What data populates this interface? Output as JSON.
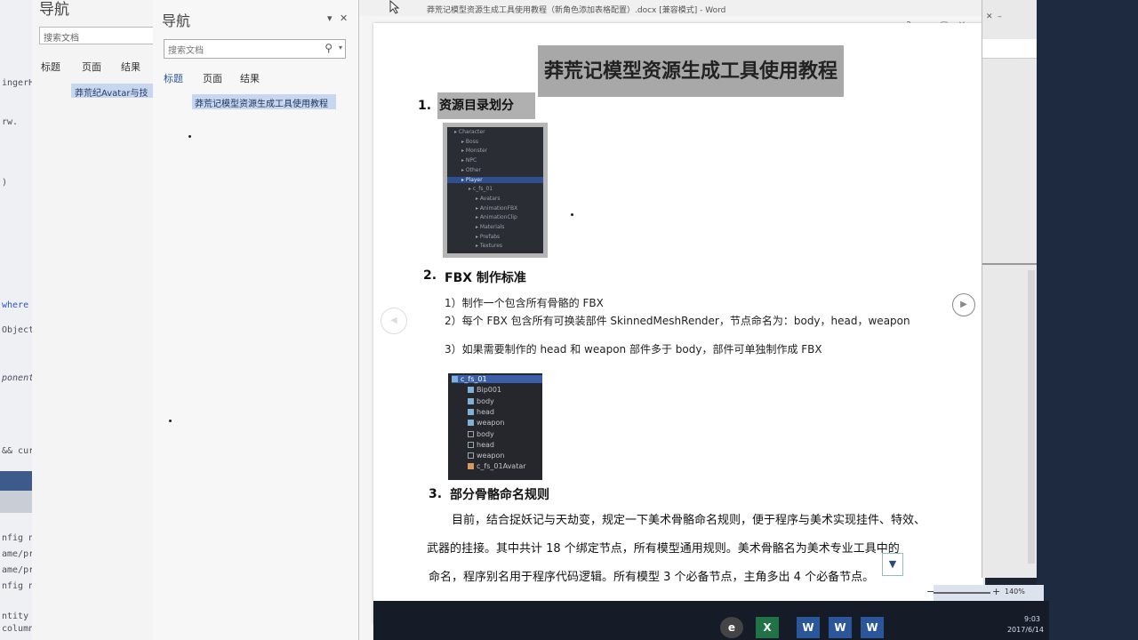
{
  "code_editor": {
    "lines": [
      "ingerHe",
      "rw.",
      ")",
      "where",
      "Object",
      "ponent<",
      "&& curIn",
      "nfig not fo",
      "ame/prefa",
      "ame/prefa",
      "nfig not fo",
      "ntity is not",
      "column <fil"
    ]
  },
  "back_nav": {
    "title": "导航",
    "search_placeholder": "搜索文档",
    "tabs": [
      "标题",
      "页面",
      "结果"
    ],
    "heading_item": "莽荒纪Avatar与技"
  },
  "nav_pane": {
    "title": "导航",
    "menu_icon": "▾",
    "close_icon": "✕",
    "search_placeholder": "搜索文档",
    "tabs": [
      "标题",
      "页面",
      "结果"
    ],
    "heading_item": "莽荒记模型资源生成工具使用教程"
  },
  "window": {
    "title": "莽荒记模型资源生成工具使用教程（新角色添加表格配置）.docx [兼容模式] - Word",
    "controls": [
      "?",
      "–",
      "▢",
      "✕"
    ]
  },
  "document": {
    "title": "莽荒记模型资源生成工具使用教程",
    "sections": [
      {
        "num": "1.",
        "heading": "资源目录划分"
      },
      {
        "num": "2.",
        "heading": "FBX 制作标准"
      },
      {
        "num": "3.",
        "heading": "部分骨骼命名规则"
      }
    ],
    "fbx_points": [
      "1）制作一个包含所有骨骼的 FBX",
      "2）每个 FBX 包含所有可换装部件 SkinnedMeshRender，节点命名为：body，head，weapon",
      "3）如果需要制作的 head 和 weapon 部件多于 body，部件可单独制作成 FBX"
    ],
    "naming_para": [
      "目前，结合捉妖记与天劫变，规定一下美术骨骼命名规则，便于程序与美术实现挂件、特效、",
      "武器的挂接。其中共计 18 个绑定节点，所有模型通用规则。美术骨骼名为美术专业工具中的",
      "命名，程序别名用于程序代码逻辑。所有模型 3 个必备节点，主角多出 4 个必备节点。"
    ]
  },
  "tree1": {
    "rows": [
      "Character",
      "Boss",
      "Monster",
      "NPC",
      "Other",
      "Player",
      "c_fs_01",
      "Avatars",
      "AnimationFBX",
      "AnimationClip",
      "Materials",
      "Prefabs",
      "Textures"
    ],
    "selected": "Player"
  },
  "tree2": {
    "rows": [
      "c_fs_01",
      "Bip001",
      "body",
      "head",
      "weapon",
      "body",
      "head",
      "weapon",
      "c_fs_01Avatar"
    ],
    "selected": "c_fs_01"
  },
  "status": {
    "zoom": "140%"
  },
  "taskbar": {
    "apps": [
      "W",
      "W",
      "X",
      "W",
      "W",
      "W"
    ],
    "time": "9:03",
    "date": "2017/6/14"
  }
}
